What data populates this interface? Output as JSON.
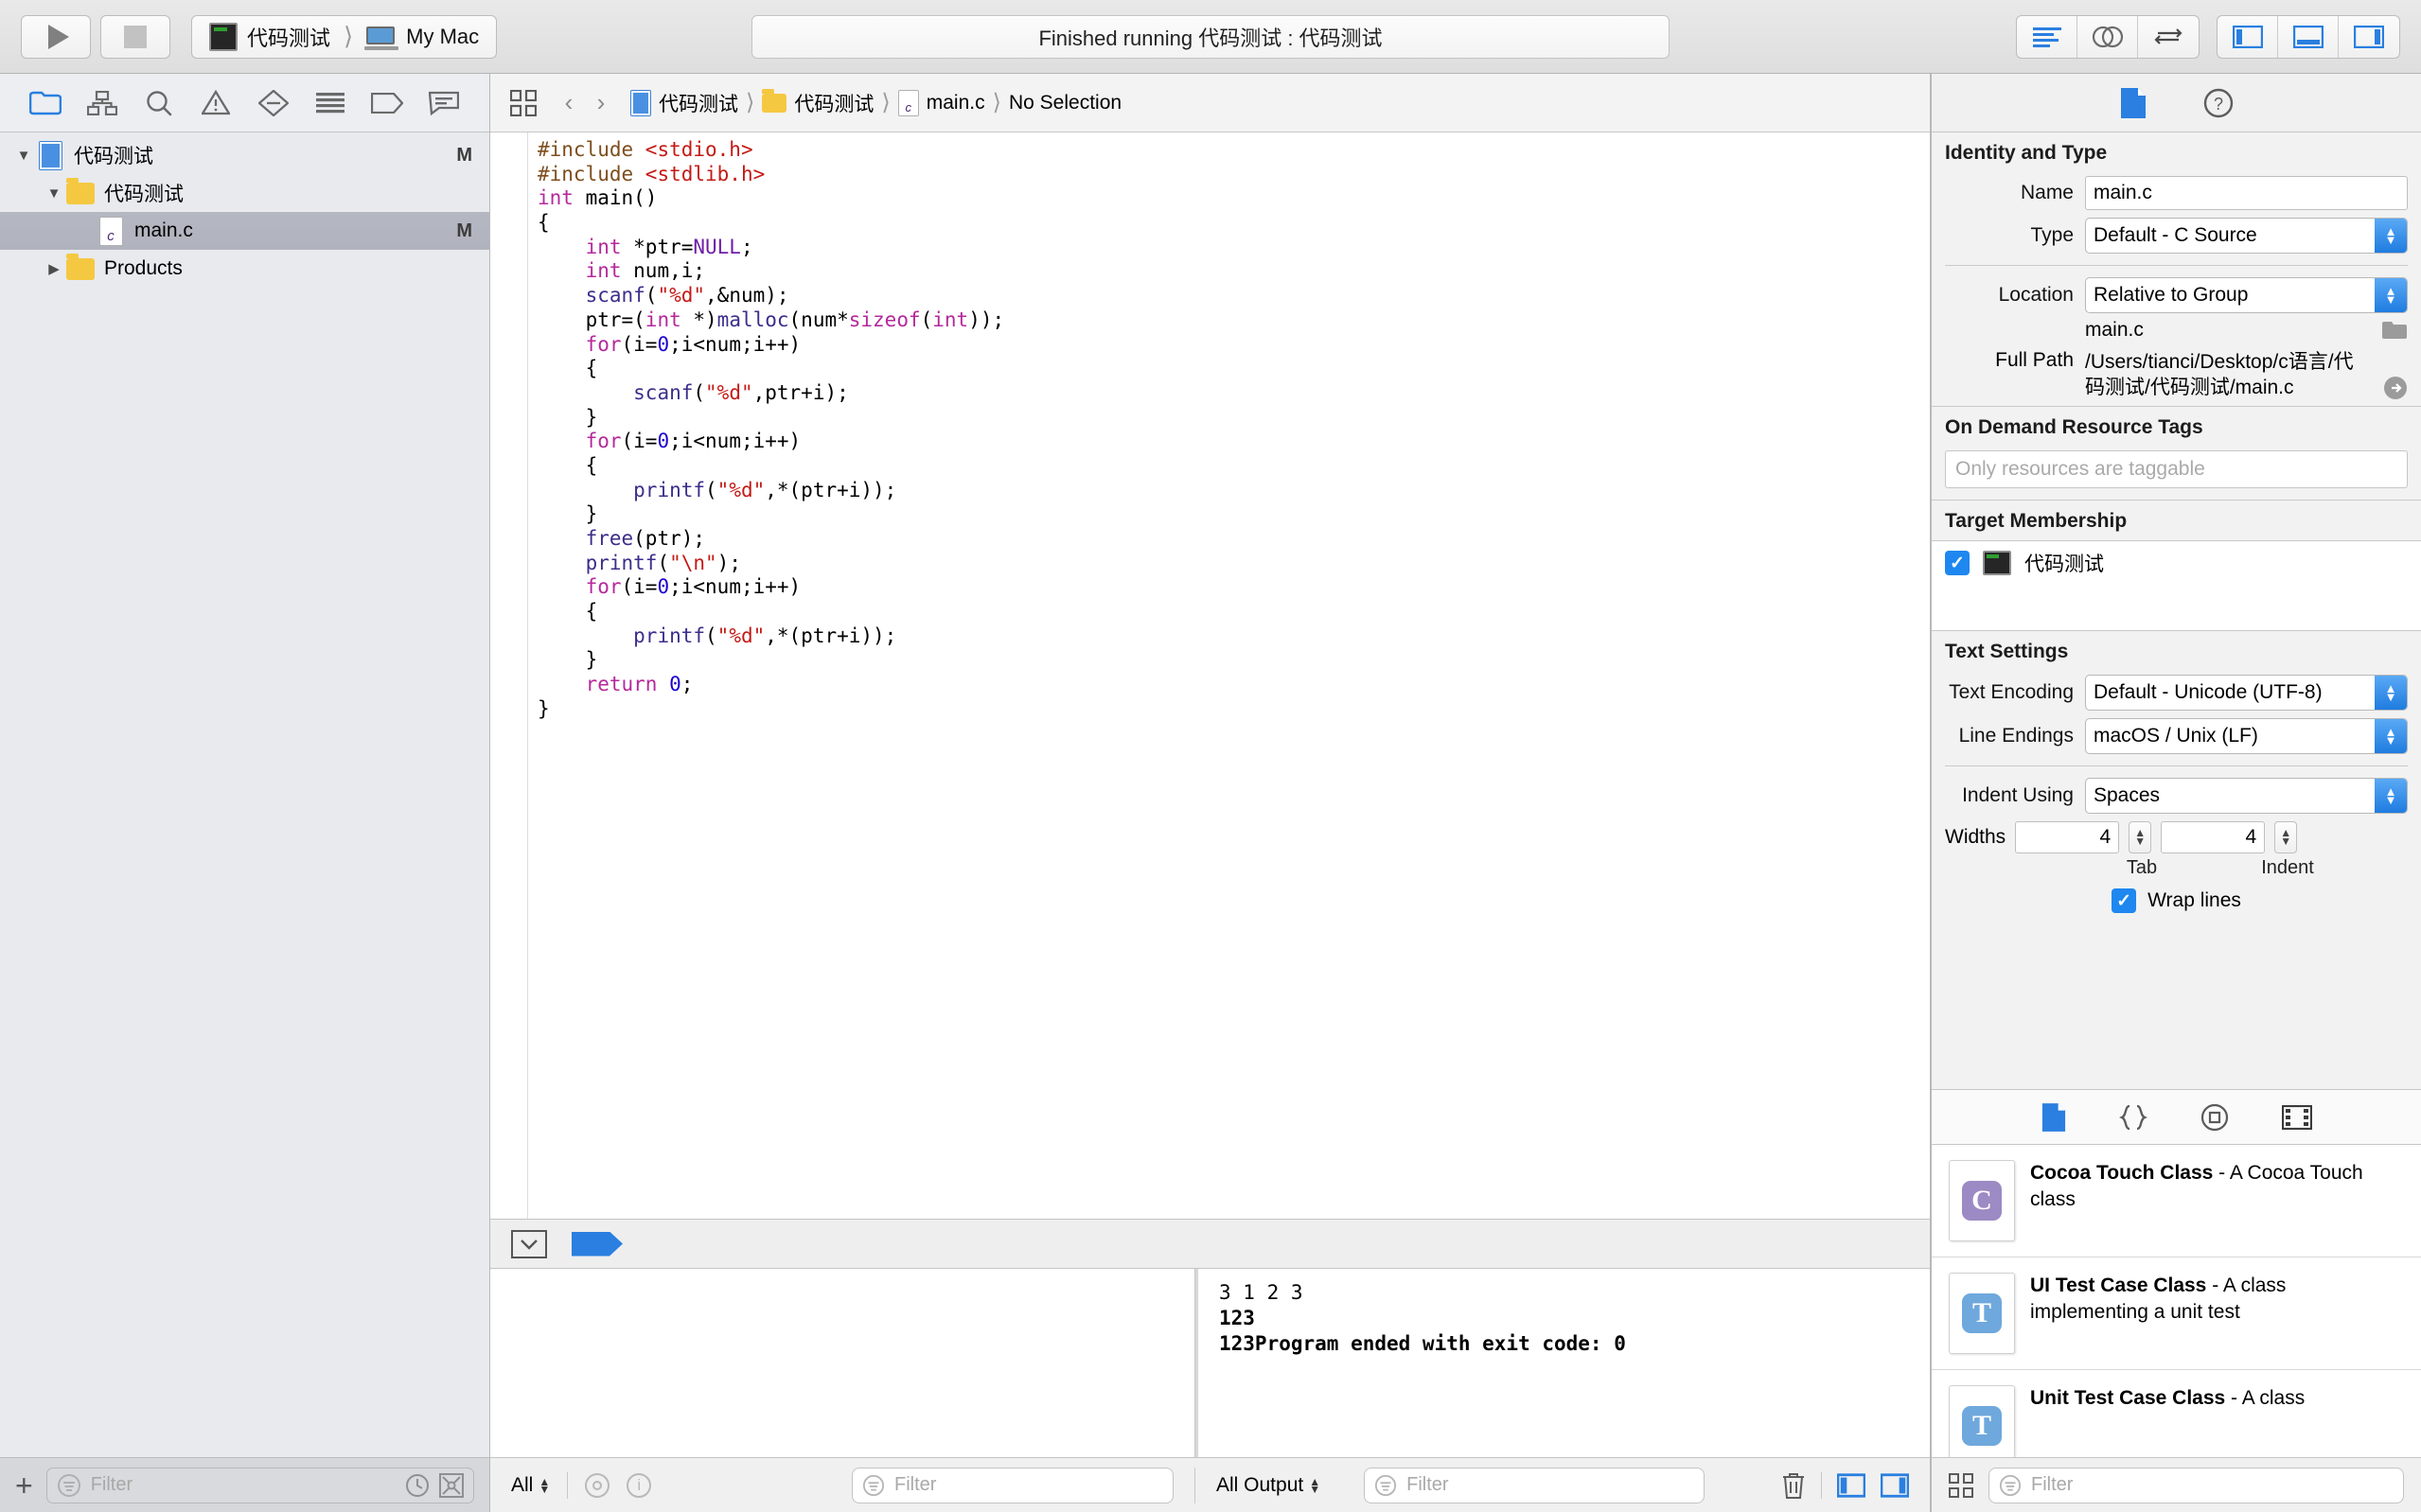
{
  "toolbar": {
    "run_label": "Run",
    "stop_label": "Stop",
    "scheme_name": "代码测试",
    "destination": "My Mac",
    "status_text": "Finished running 代码测试 : 代码测试",
    "editor_segment": [
      "standard-editor",
      "assistant-editor",
      "version-editor"
    ],
    "view_segment": [
      "navigator-toggle",
      "debug-area-toggle",
      "utilities-toggle"
    ]
  },
  "navigator": {
    "tabs": [
      "project-navigator",
      "source-control-navigator",
      "find-navigator",
      "issue-navigator",
      "test-navigator",
      "debug-navigator",
      "breakpoint-navigator",
      "report-navigator"
    ],
    "tree": [
      {
        "label": "代码测试",
        "icon": "project-icon",
        "depth": 0,
        "disclosure": "open",
        "badge": "M",
        "selected": false
      },
      {
        "label": "代码测试",
        "icon": "folder-icon",
        "depth": 1,
        "disclosure": "open",
        "badge": "",
        "selected": false
      },
      {
        "label": "main.c",
        "icon": "c-file-icon",
        "depth": 2,
        "disclosure": "none",
        "badge": "M",
        "selected": true
      },
      {
        "label": "Products",
        "icon": "folder-icon",
        "depth": 1,
        "disclosure": "closed",
        "badge": "",
        "selected": false
      }
    ],
    "add_label": "+",
    "filter_placeholder": "Filter",
    "recent_icon": "clock-icon",
    "filter_clear_icon": "x-box-icon"
  },
  "jumpbar": {
    "related_items_icon": "related-items-icon",
    "back_label": "‹",
    "forward_label": "›",
    "breadcrumbs": [
      {
        "label": "代码测试",
        "icon": "project-icon"
      },
      {
        "label": "代码测试",
        "icon": "folder-icon"
      },
      {
        "label": "main.c",
        "icon": "c-file-icon"
      },
      {
        "label": "No Selection",
        "icon": ""
      }
    ]
  },
  "editor": {
    "filename": "main.c",
    "code_lines": [
      [
        {
          "t": "#include ",
          "c": "pre"
        },
        {
          "t": "<stdio.h>",
          "c": "str"
        }
      ],
      [
        {
          "t": "#include ",
          "c": "pre"
        },
        {
          "t": "<stdlib.h>",
          "c": "str"
        }
      ],
      [
        {
          "t": "int",
          "c": "key"
        },
        {
          "t": " main()",
          "c": "plain"
        }
      ],
      [
        {
          "t": "{",
          "c": "plain"
        }
      ],
      [
        {
          "t": "    ",
          "c": "plain"
        },
        {
          "t": "int",
          "c": "key"
        },
        {
          "t": " *ptr=",
          "c": "plain"
        },
        {
          "t": "NULL",
          "c": "const"
        },
        {
          "t": ";",
          "c": "plain"
        }
      ],
      [
        {
          "t": "    ",
          "c": "plain"
        },
        {
          "t": "int",
          "c": "key"
        },
        {
          "t": " num,i;",
          "c": "plain"
        }
      ],
      [
        {
          "t": "    ",
          "c": "plain"
        },
        {
          "t": "scanf",
          "c": "fn"
        },
        {
          "t": "(",
          "c": "plain"
        },
        {
          "t": "\"%d\"",
          "c": "str"
        },
        {
          "t": ",&num);",
          "c": "plain"
        }
      ],
      [
        {
          "t": "    ptr=(",
          "c": "plain"
        },
        {
          "t": "int",
          "c": "key"
        },
        {
          "t": " *)",
          "c": "plain"
        },
        {
          "t": "malloc",
          "c": "fn"
        },
        {
          "t": "(num*",
          "c": "plain"
        },
        {
          "t": "sizeof",
          "c": "key"
        },
        {
          "t": "(",
          "c": "plain"
        },
        {
          "t": "int",
          "c": "key"
        },
        {
          "t": "));",
          "c": "plain"
        }
      ],
      [
        {
          "t": "    ",
          "c": "plain"
        },
        {
          "t": "for",
          "c": "key"
        },
        {
          "t": "(i=",
          "c": "plain"
        },
        {
          "t": "0",
          "c": "num"
        },
        {
          "t": ";i<num;i++)",
          "c": "plain"
        }
      ],
      [
        {
          "t": "    {",
          "c": "plain"
        }
      ],
      [
        {
          "t": "        ",
          "c": "plain"
        },
        {
          "t": "scanf",
          "c": "fn"
        },
        {
          "t": "(",
          "c": "plain"
        },
        {
          "t": "\"%d\"",
          "c": "str"
        },
        {
          "t": ",ptr+i);",
          "c": "plain"
        }
      ],
      [
        {
          "t": "    }",
          "c": "plain"
        }
      ],
      [
        {
          "t": "    ",
          "c": "plain"
        },
        {
          "t": "for",
          "c": "key"
        },
        {
          "t": "(i=",
          "c": "plain"
        },
        {
          "t": "0",
          "c": "num"
        },
        {
          "t": ";i<num;i++)",
          "c": "plain"
        }
      ],
      [
        {
          "t": "    {",
          "c": "plain"
        }
      ],
      [
        {
          "t": "        ",
          "c": "plain"
        },
        {
          "t": "printf",
          "c": "fn"
        },
        {
          "t": "(",
          "c": "plain"
        },
        {
          "t": "\"%d\"",
          "c": "str"
        },
        {
          "t": ",*(ptr+i));",
          "c": "plain"
        }
      ],
      [
        {
          "t": "    }",
          "c": "plain"
        }
      ],
      [
        {
          "t": "    ",
          "c": "plain"
        },
        {
          "t": "free",
          "c": "fn"
        },
        {
          "t": "(ptr);",
          "c": "plain"
        }
      ],
      [
        {
          "t": "    ",
          "c": "plain"
        },
        {
          "t": "printf",
          "c": "fn"
        },
        {
          "t": "(",
          "c": "plain"
        },
        {
          "t": "\"\\n\"",
          "c": "str"
        },
        {
          "t": ");",
          "c": "plain"
        }
      ],
      [
        {
          "t": "    ",
          "c": "plain"
        },
        {
          "t": "for",
          "c": "key"
        },
        {
          "t": "(i=",
          "c": "plain"
        },
        {
          "t": "0",
          "c": "num"
        },
        {
          "t": ";i<num;i++)",
          "c": "plain"
        }
      ],
      [
        {
          "t": "    {",
          "c": "plain"
        }
      ],
      [
        {
          "t": "        ",
          "c": "plain"
        },
        {
          "t": "printf",
          "c": "fn"
        },
        {
          "t": "(",
          "c": "plain"
        },
        {
          "t": "\"%d\"",
          "c": "str"
        },
        {
          "t": ",*(ptr+i));",
          "c": "plain"
        }
      ],
      [
        {
          "t": "    }",
          "c": "plain"
        }
      ],
      [
        {
          "t": "    ",
          "c": "plain"
        },
        {
          "t": "return",
          "c": "key"
        },
        {
          "t": " ",
          "c": "plain"
        },
        {
          "t": "0",
          "c": "num"
        },
        {
          "t": ";",
          "c": "plain"
        }
      ],
      [
        {
          "t": "}",
          "c": "plain"
        }
      ],
      []
    ],
    "highlight_line_index": 25
  },
  "debug_bar": {
    "hide_debug_icon": "hide-debug-area-icon",
    "breakpoints_icon": "breakpoints-toggle-icon"
  },
  "console": {
    "lines": [
      {
        "text": "3 1 2 3",
        "bold": false
      },
      {
        "text": "123",
        "bold": true
      },
      {
        "text": "123Program ended with exit code: 0",
        "bold": true
      }
    ]
  },
  "debug_bottom_bar": {
    "scope_label": "All",
    "eye_icon": "watch-icon",
    "info_icon": "info-icon",
    "variables_filter_placeholder": "Filter",
    "output_scope_label": "All Output",
    "console_filter_placeholder": "Filter",
    "trash_icon": "trash-icon",
    "split_icons": [
      "show-variables-view",
      "show-console-view"
    ]
  },
  "inspector": {
    "tabs": [
      "file-inspector",
      "quick-help-inspector"
    ],
    "identity": {
      "section_title": "Identity and Type",
      "name_label": "Name",
      "name_value": "main.c",
      "type_label": "Type",
      "type_value": "Default - C Source",
      "location_label": "Location",
      "location_value": "Relative to Group",
      "relative_path": "main.c",
      "choose_folder_icon": "folder-choose-icon",
      "full_path_label": "Full Path",
      "full_path_value": "/Users/tianci/Desktop/c语言/代码测试/代码测试/main.c",
      "reveal_icon": "reveal-in-finder-icon"
    },
    "odr": {
      "section_title": "On Demand Resource Tags",
      "placeholder": "Only resources are taggable"
    },
    "target_membership": {
      "section_title": "Target Membership",
      "items": [
        {
          "label": "代码测试",
          "checked": true
        }
      ]
    },
    "text_settings": {
      "section_title": "Text Settings",
      "text_encoding_label": "Text Encoding",
      "text_encoding_value": "Default - Unicode (UTF-8)",
      "line_endings_label": "Line Endings",
      "line_endings_value": "macOS / Unix (LF)",
      "indent_using_label": "Indent Using",
      "indent_using_value": "Spaces",
      "widths_label": "Widths",
      "tab_width": "4",
      "indent_width": "4",
      "tab_caption": "Tab",
      "indent_caption": "Indent",
      "wrap_lines_label": "Wrap lines",
      "wrap_lines_checked": true
    }
  },
  "library": {
    "tabs": [
      "file-template-library",
      "code-snippet-library",
      "object-library",
      "media-library"
    ],
    "items": [
      {
        "icon_letter": "C",
        "icon_color": "#9b8ac4",
        "title": "Cocoa Touch Class",
        "desc": "- A Cocoa Touch class"
      },
      {
        "icon_letter": "T",
        "icon_color": "#6fa8dc",
        "title": "UI Test Case Class",
        "desc": "- A class implementing a unit test"
      },
      {
        "icon_letter": "T",
        "icon_color": "#6fa8dc",
        "title": "Unit Test Case Class",
        "desc": "- A class"
      }
    ],
    "layout_icon": "grid-layout-icon",
    "filter_placeholder": "Filter"
  },
  "colors": {
    "accent": "#1e87f0",
    "selection": "#b5b7c2",
    "string": "#c41a16",
    "keyword": "#b5299c",
    "function": "#3b2e8c",
    "number": "#1c00cf",
    "preprocessor": "#7d4e1d"
  }
}
